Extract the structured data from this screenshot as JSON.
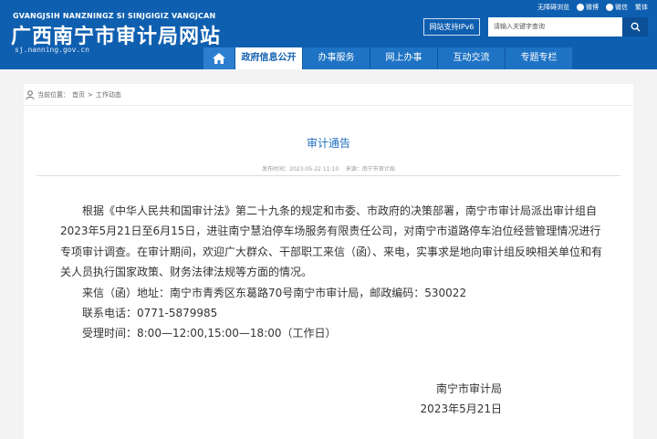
{
  "header": {
    "pinyin": "GVANGJSIH NANZNINGZ SI SINJGIGIZ VANGJCAN",
    "site_title": "广西南宁市审计局网站",
    "domain": "sj.nanning.gov.cn",
    "top_links": [
      "无障碍浏览",
      "微博",
      "微信",
      "繁体"
    ],
    "ipv6_label": "网站支持IPv6",
    "search_placeholder": "请输入关键字查询"
  },
  "nav": {
    "items": [
      "政府信息公开",
      "办事服务",
      "网上办事",
      "互动交流",
      "专题专栏"
    ],
    "active": "政府信息公开"
  },
  "breadcrumb": {
    "label": "当前位置：",
    "items": [
      "首页",
      "工作动态"
    ],
    "separator": ">"
  },
  "article": {
    "title": "审计通告",
    "published_label": "发布时间：",
    "published": "2023-05-22 11:10",
    "source_label": "来源：",
    "source": "南宁市审计局",
    "paragraph": "根据《中华人民共和国审计法》第二十九条的规定和市委、市政府的决策部署，南宁市审计局派出审计组自2023年5月21日至6月15日，进驻南宁慧泊停车场服务有限责任公司，对南宁市道路停车泊位经营管理情况进行专项审计调查。在审计期间，欢迎广大群众、干部职工来信（函）、来电，实事求是地向审计组反映相关单位和有关人员执行国家政策、财务法律法规等方面的情况。",
    "address_line": "来信（函）地址：南宁市青秀区东葛路70号南宁市审计局，邮政编码：530022",
    "phone_line": "联系电话：0771-5879985",
    "hours_line": "受理时间：8:00—12:00,15:00—18:00（工作日）",
    "signature": "南宁市审计局",
    "date": "2023年5月21日"
  },
  "colors": {
    "header_bg": "#0f5fb0",
    "nav_bg": "#1e73c4",
    "title_color": "#1f6fbf",
    "page_bg": "#f3f3f3"
  }
}
